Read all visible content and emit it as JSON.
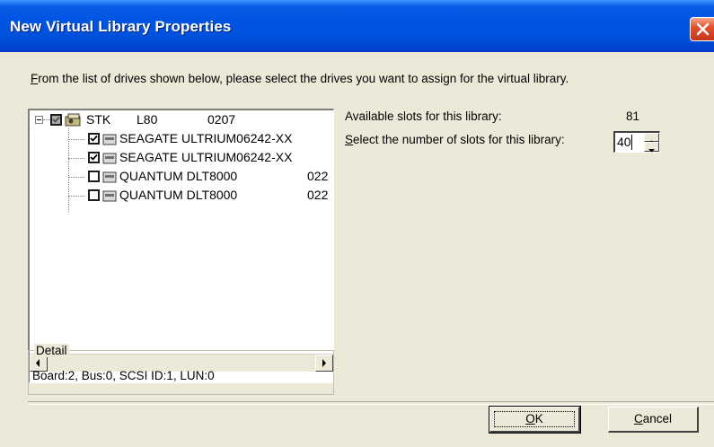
{
  "window": {
    "title": "New Virtual Library Properties",
    "close_glyph": "×"
  },
  "instructions": {
    "text": "From the list of drives shown below, please select the drives you want to assign for the virtual library.",
    "accel": "F"
  },
  "tree": {
    "root": {
      "name": "STK",
      "model": "L80",
      "rev": "0207",
      "checked": "partial"
    },
    "drives": [
      {
        "label": "SEAGATE ULTRIUM06242-XX",
        "checked": true
      },
      {
        "label": "SEAGATE ULTRIUM06242-XX",
        "checked": true
      },
      {
        "label": "QUANTUM DLT8000",
        "rev": "022",
        "checked": false
      },
      {
        "label": "QUANTUM DLT8000",
        "rev": "022",
        "checked": false
      }
    ]
  },
  "detail": {
    "label": "Detail",
    "value": "Board:2, Bus:0, SCSI ID:1, LUN:0"
  },
  "slots": {
    "available_label": "Available slots for this library:",
    "available_value": "81",
    "select_label": "Select the number of slots for this library:",
    "select_value": "40"
  },
  "buttons": {
    "ok": "OK",
    "cancel": "Cancel"
  },
  "colors": {
    "titlebar": "#0054e3",
    "dialog_bg": "#ece9d8",
    "close": "#e3532d"
  }
}
